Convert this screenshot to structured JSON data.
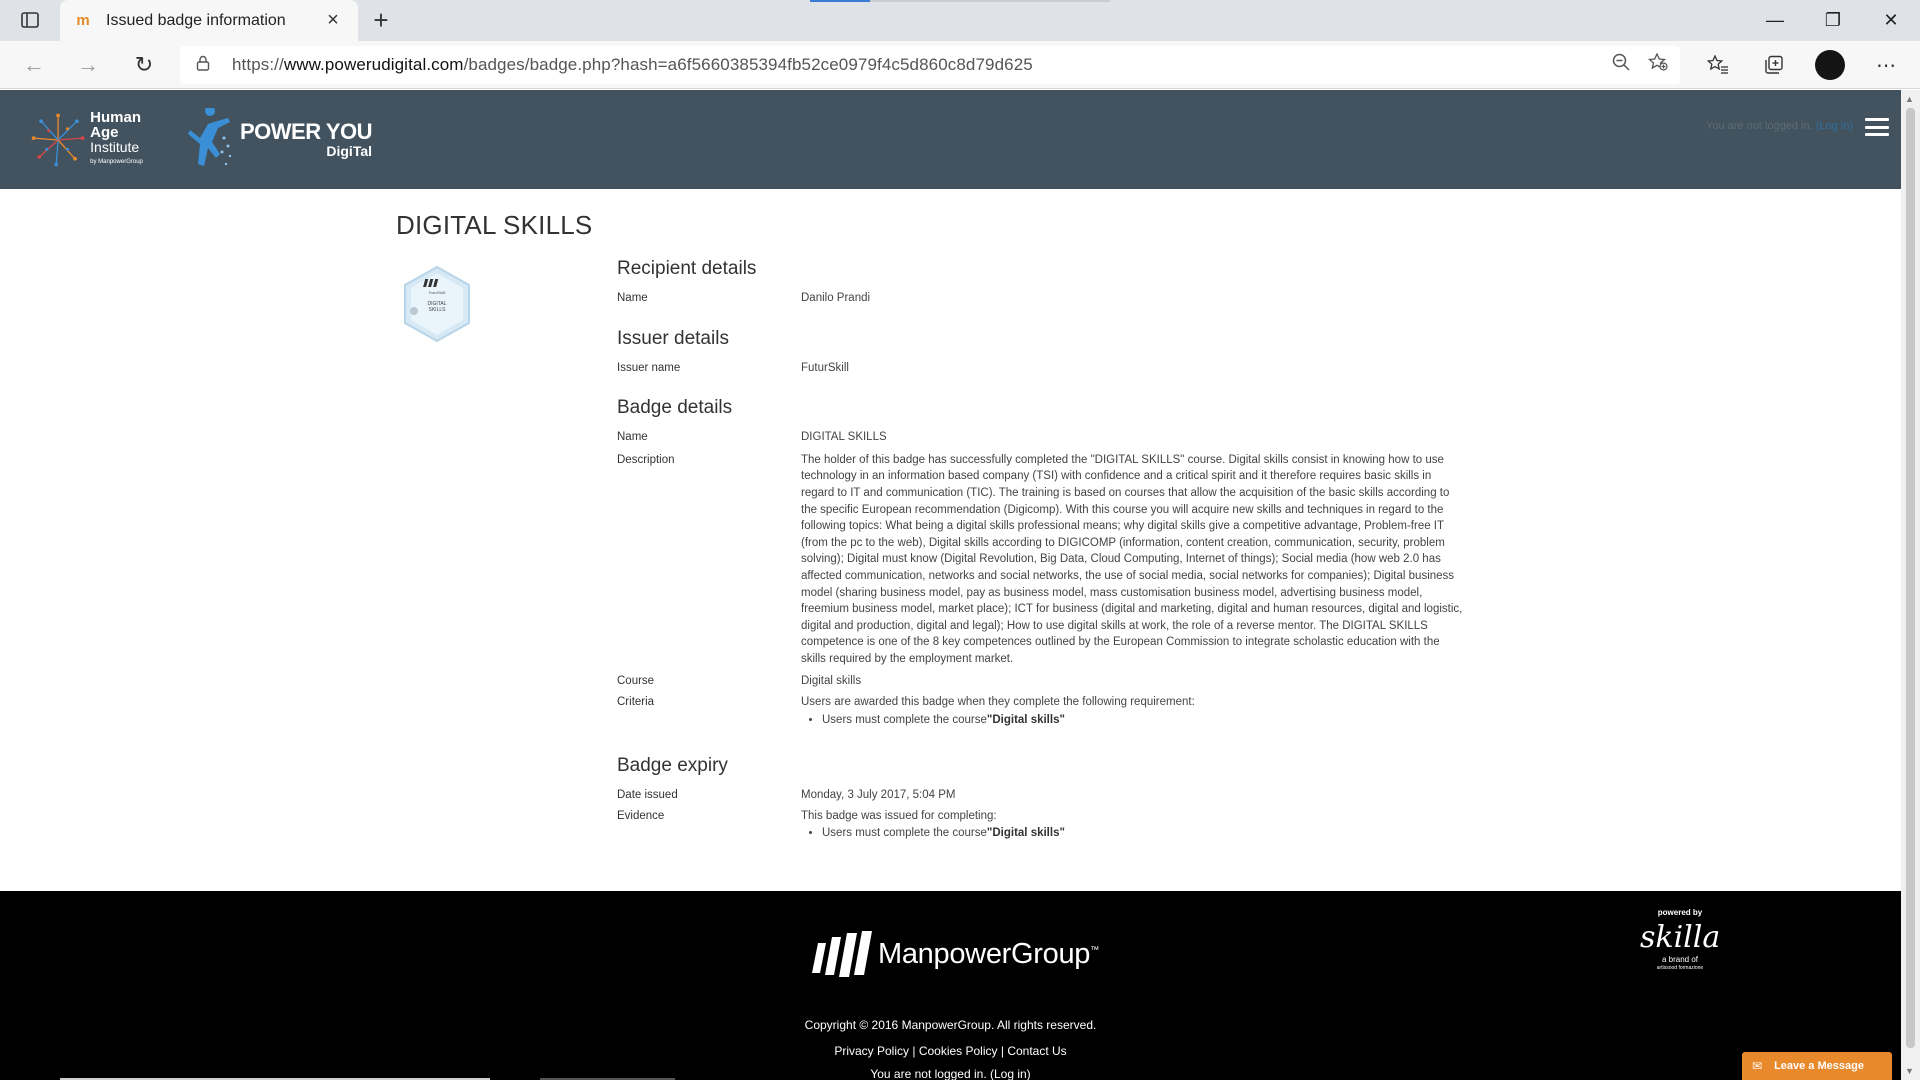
{
  "browser": {
    "tab_title": "Issued badge information",
    "url_scheme": "https://",
    "url_host": "www.powerudigital.com",
    "url_path": "/badges/badge.php?hash=a6f5660385394fb52ce0979f4c5d860c8d79d625"
  },
  "header": {
    "hai_line1": "Human Age",
    "hai_line2": "Institute",
    "hai_line3": "by ManpowerGroup",
    "power_line1": "POWER YOU",
    "power_line2": "DigiTal",
    "not_logged_in": "You are not logged in.",
    "login_link": "(Log in)"
  },
  "page": {
    "title": "DIGITAL SKILLS",
    "badge_image_text": [
      "FuturSkill",
      "DIGITAL",
      "SKILLS"
    ]
  },
  "recipient": {
    "heading": "Recipient details",
    "name_label": "Name",
    "name_value": "Danilo Prandi"
  },
  "issuer": {
    "heading": "Issuer details",
    "issuer_label": "Issuer name",
    "issuer_value": "FuturSkill"
  },
  "badge": {
    "heading": "Badge details",
    "name_label": "Name",
    "name_value": "DIGITAL SKILLS",
    "description_label": "Description",
    "description_lines": [
      "The holder of this badge has successfully completed the \"DIGITAL SKILLS\" course. Digital skills consist in knowing how to use",
      "technology in an information based company (TSI) with confidence and a critical spirit and it therefore requires basic skills in",
      "regard to IT and communication (TIC). The training is based on courses that allow the acquisition of the basic skills according to",
      "the specific European recommendation (Digicomp). With this course you will acquire new skills and techniques in regard to the",
      "following topics: What being a digital skills professional means; why digital skills give a competitive advantage, Problem-free IT",
      "(from the pc to the web), Digital skills according to DIGICOMP (information, content creation, communication, security, problem",
      "solving); Digital must know (Digital Revolution, Big Data, Cloud Computing, Internet of things); Social media (how web 2.0 has",
      "affected communication, networks and social networks, the use of social media, social networks for companies); Digital business",
      "model (sharing business model, pay as business model, mass customisation business model, advertising business model,",
      "freemium business model, market place); ICT for business (digital and marketing, digital and human resources, digital and logistic,",
      "digital and production, digital and legal); How to use digital skills at work, the role of a reverse mentor. The DIGITAL SKILLS",
      "competence is one of the 8 key competences outlined by the European Commission to integrate scholastic education with the",
      "skills required by the employment market."
    ],
    "course_label": "Course",
    "course_value": "Digital skills",
    "criteria_label": "Criteria",
    "criteria_intro": "Users are awarded this badge when they complete the following requirement:",
    "criteria_item_prefix": "Users must complete the course",
    "criteria_item_course": "\"Digital skills\""
  },
  "expiry": {
    "heading": "Badge expiry",
    "date_label": "Date issued",
    "date_value": "Monday, 3 July 2017, 5:04 PM",
    "evidence_label": "Evidence",
    "evidence_intro": "This badge was issued for completing:",
    "evidence_item_prefix": "Users must complete the course",
    "evidence_item_course": "\"Digital skills\""
  },
  "footer": {
    "brand": "ManpowerGroup",
    "copyright": "Copyright © 2016 ManpowerGroup. All rights reserved.",
    "privacy": "Privacy Policy",
    "cookies": "Cookies Policy",
    "contact": "Contact Us",
    "separator": " | ",
    "not_logged_in": "You are not logged in. (Log in)",
    "powered_by": "powered by",
    "skilla": "skilla",
    "skilla_brand_line1": "a brand of",
    "skilla_brand_line2": "artissood formazione",
    "leave_message": "Leave a Message"
  },
  "colors": {
    "header_bg": "#42535f",
    "footer_bg": "#000000",
    "leave_message_bg": "#e8892b"
  }
}
